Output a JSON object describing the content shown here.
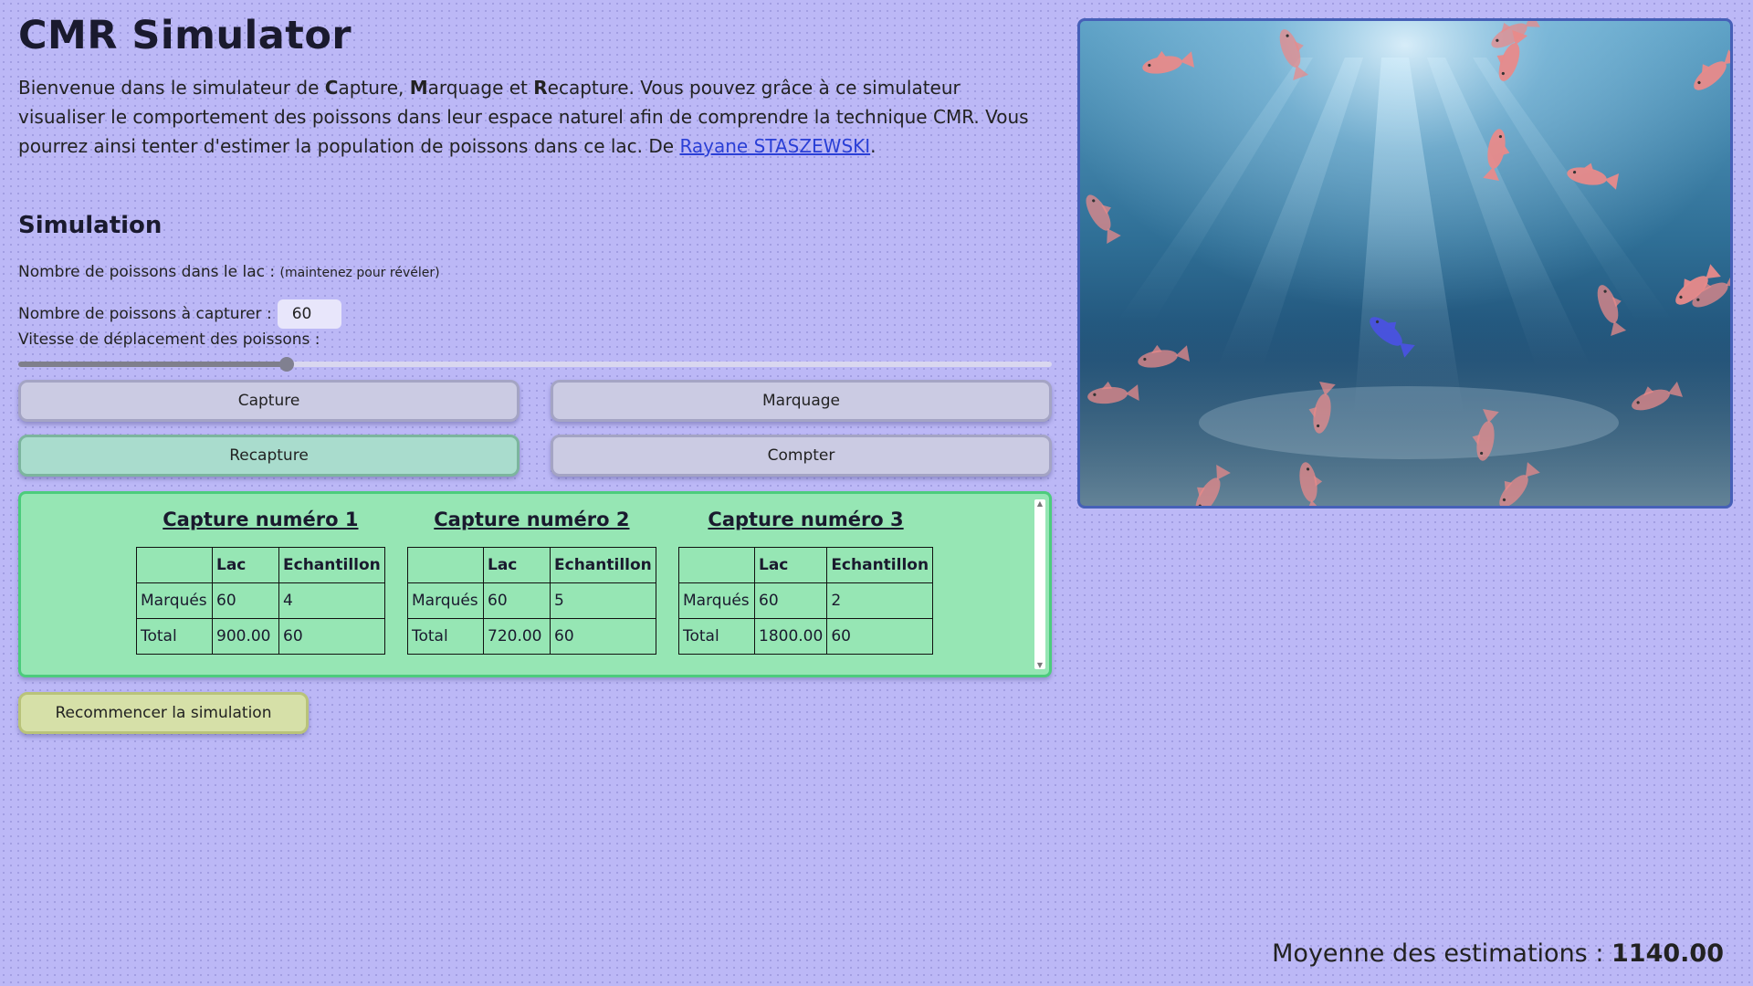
{
  "title": "CMR Simulator",
  "intro": {
    "p1": "Bienvenue dans le simulateur de ",
    "c": "C",
    "p2": "apture, ",
    "m": "M",
    "p3": "arquage et ",
    "r": "R",
    "p4": "ecapture. Vous pouvez grâce à ce simulateur visualiser le comportement des poissons dans leur espace naturel afin de comprendre la technique CMR. Vous pourrez ainsi tenter d'estimer la population de poissons dans ce lac. De ",
    "author": "Rayane STASZEWSKI",
    "end": "."
  },
  "simulation": {
    "heading": "Simulation",
    "fish_count_label": "Nombre de poissons dans le lac : ",
    "fish_count_hint": "(maintenez pour révéler)",
    "capture_label": "Nombre de poissons à capturer : ",
    "capture_value": "60",
    "speed_label": "Vitesse de déplacement des poissons :",
    "speed_value": 0.26
  },
  "buttons": {
    "capture": "Capture",
    "marquage": "Marquage",
    "recapture": "Recapture",
    "compter": "Compter",
    "restart": "Recommencer la simulation"
  },
  "captures": [
    {
      "title": "Capture numéro 1",
      "headers": [
        "",
        "Lac",
        "Echantillon"
      ],
      "rows": [
        [
          "Marqués",
          "60",
          "4"
        ],
        [
          "Total",
          "900.00",
          "60"
        ]
      ]
    },
    {
      "title": "Capture numéro 2",
      "headers": [
        "",
        "Lac",
        "Echantillon"
      ],
      "rows": [
        [
          "Marqués",
          "60",
          "5"
        ],
        [
          "Total",
          "720.00",
          "60"
        ]
      ]
    },
    {
      "title": "Capture numéro 3",
      "headers": [
        "",
        "Lac",
        "Echantillon"
      ],
      "rows": [
        [
          "Marqués",
          "60",
          "2"
        ],
        [
          "Total",
          "1800.00",
          "60"
        ]
      ]
    }
  ],
  "average": {
    "label": "Moyenne des estimations : ",
    "value": "1140.00"
  },
  "colors": {
    "background": "#bcb8f6",
    "results_bg": "#96e6b4",
    "recapture_active": "#a9dccd",
    "restart_bg": "#d6e0a8",
    "fish_red": "#e88a8a",
    "fish_blue": "#4a52e0"
  }
}
